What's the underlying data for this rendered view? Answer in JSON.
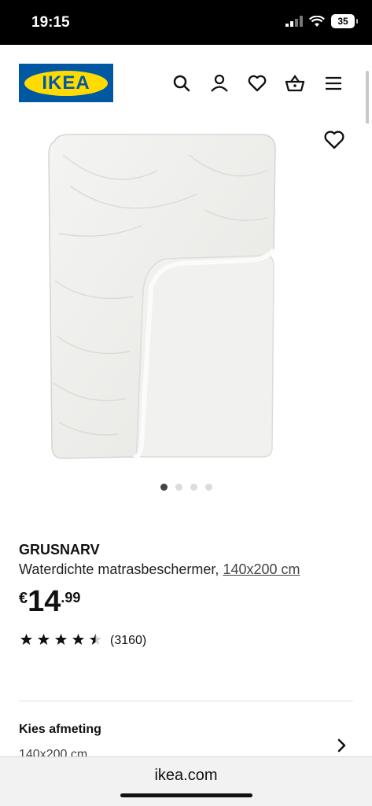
{
  "status": {
    "time": "19:15",
    "battery": "35"
  },
  "header": {
    "logo_text": "IKEA"
  },
  "icons": {
    "search": "search-icon",
    "profile": "profile-icon",
    "wishlist": "heart-icon",
    "cart": "basket-icon",
    "menu": "menu-icon",
    "favorite": "heart-icon",
    "chevron": "chevron-right-icon"
  },
  "gallery": {
    "image_count": 4,
    "active_index": 0
  },
  "product": {
    "name": "GRUSNARV",
    "description": "Waterdichte matrasbeschermer, ",
    "size_link": "140x200 cm",
    "price_currency": "€",
    "price_int": "14",
    "price_dec": ".99",
    "rating": 4.5,
    "rating_count": "(3160)"
  },
  "size_select": {
    "label": "Kies afmeting",
    "value": "140x200 cm"
  },
  "browser": {
    "url": "ikea.com"
  },
  "colors": {
    "ikea_blue": "#0058a3",
    "ikea_yellow": "#ffdb00"
  }
}
